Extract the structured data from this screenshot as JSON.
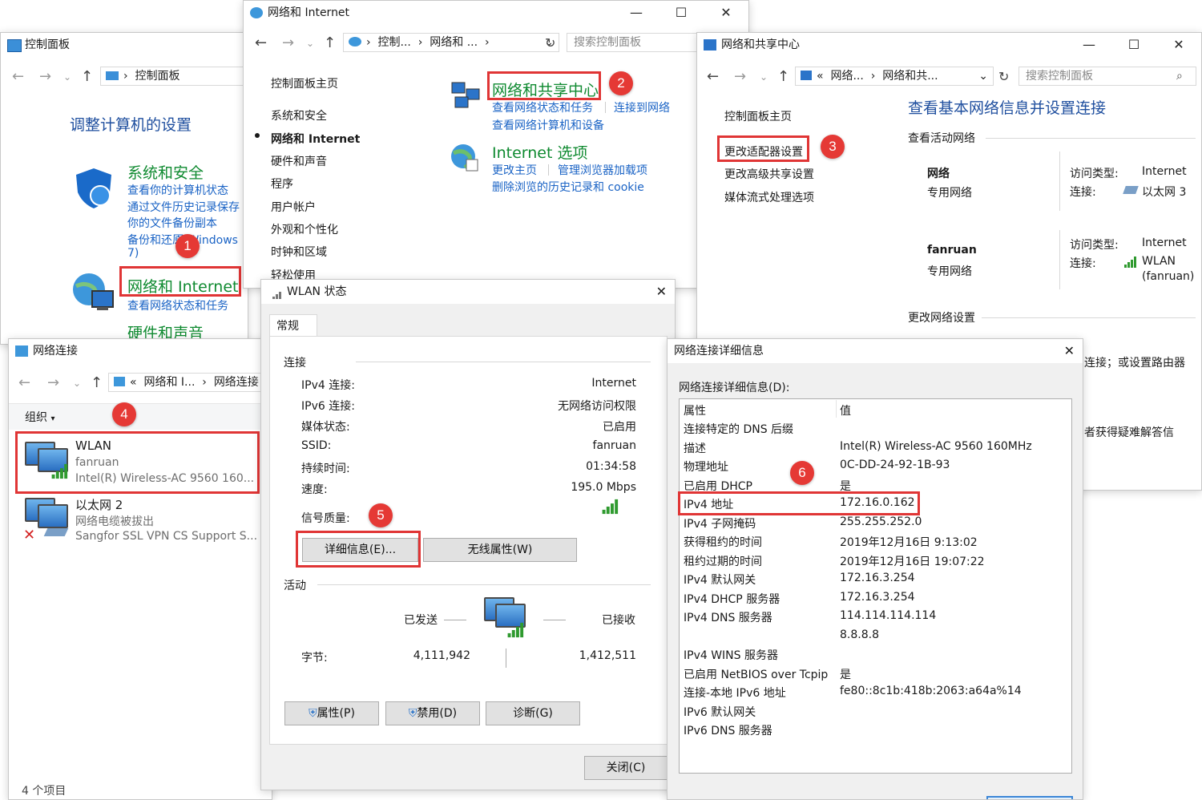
{
  "colors": {
    "accent_red": "#e03535",
    "link_blue": "#1a63c5",
    "category_green": "#0f8a30"
  },
  "cp": {
    "title": "控制面板",
    "address": "控制面板",
    "heading": "调整计算机的设置",
    "cat1": {
      "title": "系统和安全",
      "links": [
        "查看你的计算机状态",
        "通过文件历史记录保存",
        "你的文件备份副本",
        "备份和还原(Windows",
        "7)"
      ]
    },
    "cat2": {
      "title": "网络和 Internet",
      "link": "查看网络状态和任务"
    },
    "cat3": {
      "title": "硬件和声音"
    },
    "icons": [
      "shield-icon",
      "globe-network-icon"
    ]
  },
  "ni": {
    "title": "网络和 Internet",
    "addr": [
      "控制...",
      "网络和 ..."
    ],
    "search_placeholder": "搜索控制面板",
    "sidebar": [
      "控制面板主页",
      "系统和安全",
      "网络和 Internet",
      "硬件和声音",
      "程序",
      "用户帐户",
      "外观和个性化",
      "时钟和区域",
      "轻松使用"
    ],
    "nsc": {
      "title": "网络和共享中心",
      "links": [
        "查看网络状态和任务",
        "连接到网络",
        "查看网络计算机和设备"
      ]
    },
    "ie": {
      "title": "Internet 选项",
      "links": [
        "更改主页",
        "管理浏览器加载项",
        "删除浏览的历史记录和 cookie"
      ]
    }
  },
  "nsc": {
    "title": "网络和共享中心",
    "addr": [
      "网络...",
      "网络和共..."
    ],
    "search_placeholder": "搜索控制面板",
    "sidebar": [
      "控制面板主页",
      "更改适配器设置",
      "更改高级共享设置",
      "媒体流式处理选项"
    ],
    "heading": "查看基本网络信息并设置连接",
    "active_label": "查看活动网络",
    "net1": {
      "name": "网络",
      "type": "专用网络",
      "access_label": "访问类型:",
      "access": "Internet",
      "conn_label": "连接:",
      "conn": "以太网 3"
    },
    "net2": {
      "name": "fanruan",
      "type": "专用网络",
      "access_label": "访问类型:",
      "access": "Internet",
      "conn_label": "连接:",
      "conn": "WLAN",
      "conn2": "(fanruan)"
    },
    "change_label": "更改网络设置",
    "partial1": "连接；或设置路由器",
    "partial2": "者获得疑难解答信"
  },
  "nc": {
    "title": "网络连接",
    "addr": [
      "网络和 I...",
      "网络连接"
    ],
    "organize": "组织",
    "items": [
      {
        "name": "WLAN",
        "sub": "fanruan",
        "dev": "Intel(R) Wireless-AC 9560 160..."
      },
      {
        "name": "以太网 2",
        "sub": "网络电缆被拔出",
        "dev": "Sangfor SSL VPN CS Support S..."
      }
    ],
    "status": "4 个项目"
  },
  "wlan": {
    "title": "WLAN 状态",
    "tab": "常规",
    "section_conn": "连接",
    "rows": [
      {
        "label": "IPv4 连接:",
        "value": "Internet"
      },
      {
        "label": "IPv6 连接:",
        "value": "无网络访问权限"
      },
      {
        "label": "媒体状态:",
        "value": "已启用"
      },
      {
        "label": "SSID:",
        "value": "fanruan"
      },
      {
        "label": "持续时间:",
        "value": "01:34:58"
      },
      {
        "label": "速度:",
        "value": "195.0 Mbps"
      }
    ],
    "signal_label": "信号质量:",
    "btn_details": "详细信息(E)...",
    "btn_wireless": "无线属性(W)",
    "section_activity": "活动",
    "sent": "已发送",
    "recv": "已接收",
    "bytes_label": "字节:",
    "bytes_sent": "4,111,942",
    "bytes_recv": "1,412,511",
    "btn_props": "属性(P)",
    "btn_disable": "禁用(D)",
    "btn_diag": "诊断(G)",
    "btn_close": "关闭(C)"
  },
  "details": {
    "title": "网络连接详细信息",
    "label": "网络连接详细信息(D):",
    "col_prop": "属性",
    "col_val": "值",
    "rows": [
      {
        "p": "连接特定的 DNS 后缀",
        "v": ""
      },
      {
        "p": "描述",
        "v": "Intel(R) Wireless-AC 9560 160MHz"
      },
      {
        "p": "物理地址",
        "v": "0C-DD-24-92-1B-93"
      },
      {
        "p": "已启用 DHCP",
        "v": "是"
      },
      {
        "p": "IPv4 地址",
        "v": "172.16.0.162"
      },
      {
        "p": "IPv4 子网掩码",
        "v": "255.255.252.0"
      },
      {
        "p": "获得租约的时间",
        "v": "2019年12月16日 9:13:02"
      },
      {
        "p": "租约过期的时间",
        "v": "2019年12月16日 19:07:22"
      },
      {
        "p": "IPv4 默认网关",
        "v": "172.16.3.254"
      },
      {
        "p": "IPv4 DHCP 服务器",
        "v": "172.16.3.254"
      },
      {
        "p": "IPv4 DNS 服务器",
        "v": "114.114.114.114"
      },
      {
        "p": "",
        "v": "8.8.8.8"
      },
      {
        "p": "IPv4 WINS 服务器",
        "v": ""
      },
      {
        "p": "已启用 NetBIOS over Tcpip",
        "v": "是"
      },
      {
        "p": "连接-本地 IPv6 地址",
        "v": "fe80::8c1b:418b:2063:a64a%14"
      },
      {
        "p": "IPv6 默认网关",
        "v": ""
      },
      {
        "p": "IPv6 DNS 服务器",
        "v": ""
      }
    ]
  },
  "markers": [
    "1",
    "2",
    "3",
    "4",
    "5",
    "6"
  ]
}
